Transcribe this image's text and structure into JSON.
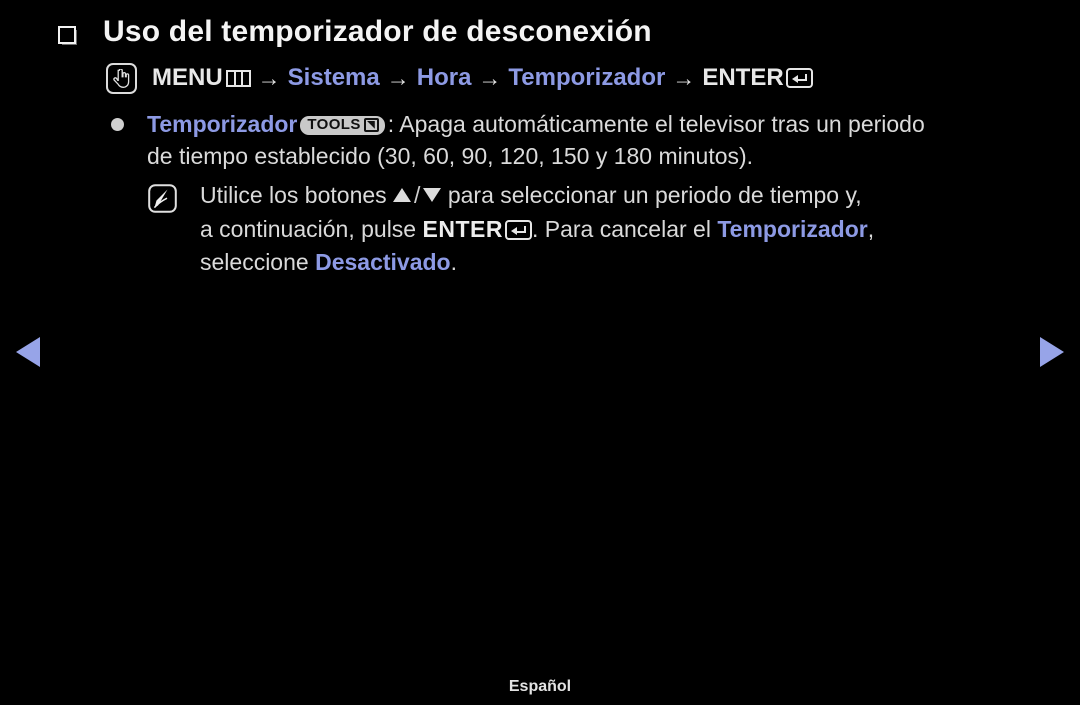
{
  "page": {
    "background_color": "#000000",
    "text_color": "#dadada",
    "accent_color": "#8d9ae4",
    "language_footer": "Español"
  },
  "heading": {
    "bullet_icon": "square-bullet-icon",
    "title": "Uso del temporizador de desconexión"
  },
  "menu_path": {
    "hand_icon": "hand-pointer-icon",
    "menu_label": "MENU",
    "menu_glyph_icon": "menu-grid-icon",
    "arrow1": "→",
    "step1": "Sistema",
    "arrow2": "→",
    "step2": "Hora",
    "arrow3": "→",
    "step3": "Temporizador",
    "arrow4": "→",
    "enter_label": "ENTER",
    "enter_glyph_icon": "enter-key-icon"
  },
  "bullet": {
    "dot_icon": "round-bullet-icon",
    "term": "Temporizador",
    "tools_badge_label": "TOOLS",
    "tools_badge_icon": "tools-arrow-icon",
    "text_part1": ": Apaga automáticamente el televisor tras un periodo",
    "text_part2": "de tiempo establecido (30, 60, 90, 120, 150 y 180 minutos).",
    "timer_options": [
      30,
      60,
      90,
      120,
      150,
      180
    ],
    "timer_unit": "minutos"
  },
  "note": {
    "note_icon": "note-pen-icon",
    "line1_a": "Utilice los botones",
    "up_arrow_icon": "triangle-up-icon",
    "slash": "/",
    "down_arrow_icon": "triangle-down-icon",
    "line1_b": "para seleccionar un periodo de tiempo y,",
    "line2_a": "a continuación, pulse",
    "enter_label": "ENTER",
    "enter_glyph_icon": "enter-key-icon",
    "line2_b": ". Para cancelar el",
    "line2_term": "Temporizador",
    "line2_c": ",",
    "line3_a": "seleccione",
    "line3_term": "Desactivado",
    "line3_b": "."
  },
  "navigation": {
    "prev_icon": "triangle-left-icon",
    "next_icon": "triangle-right-icon",
    "arrow_color": "#97a4e8"
  },
  "footer": {
    "label": "Español"
  }
}
